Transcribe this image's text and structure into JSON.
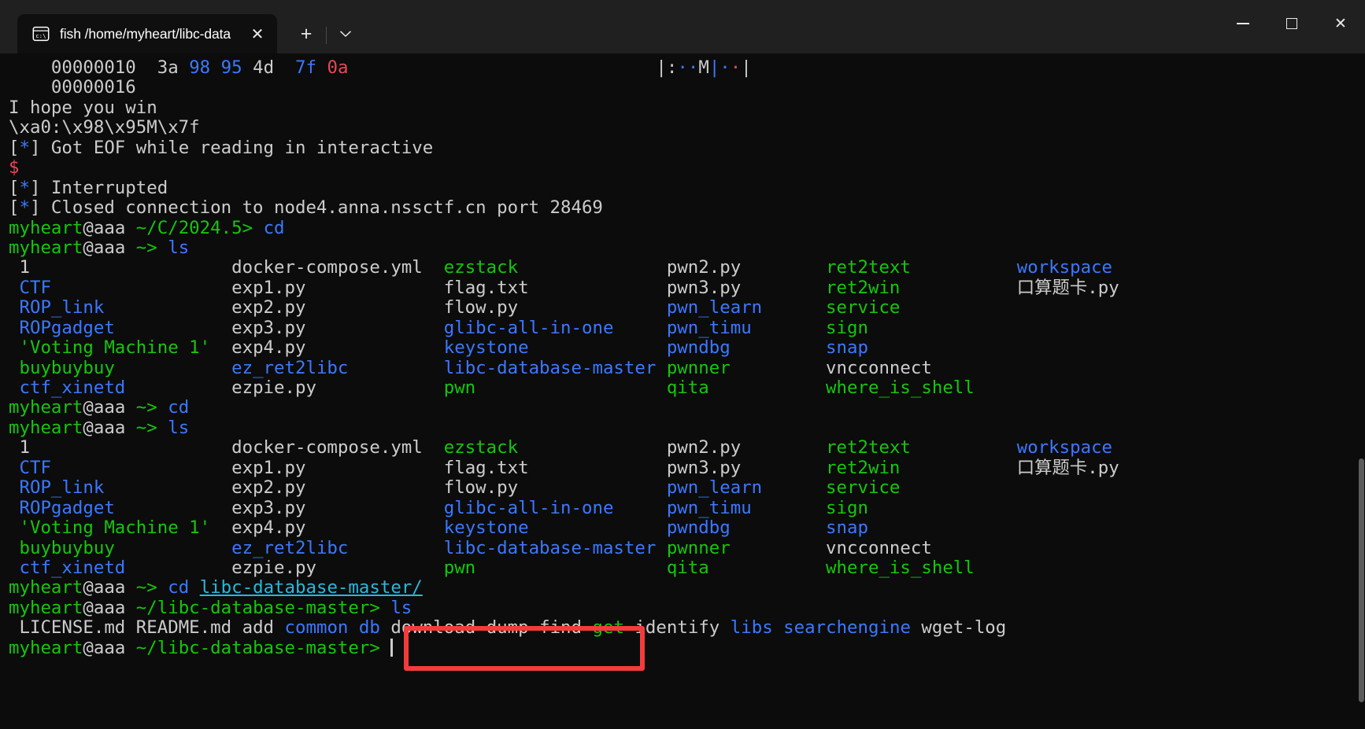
{
  "window": {
    "tab": {
      "icon": "console-cmd-icon",
      "title": "fish /home/myheart/libc-data",
      "close_label": "✕"
    },
    "new_tab_label": "+",
    "dropdown_label": "⌄",
    "controls": {
      "minimize": "minimize",
      "maximize": "maximize",
      "close": "✕"
    }
  },
  "colors": {
    "terminal_bg": "#0c0c0c",
    "chrome_bg": "#202020",
    "tab_bg": "#0f0f0f",
    "white": "#cccccc",
    "blue": "#3b78ff",
    "green": "#16c60c",
    "cyan": "#29b8db",
    "red": "#e74856",
    "annotation_red": "#f43b3b"
  },
  "annotation": {
    "name": "red-highlight-box",
    "target_text": "libc-database-master"
  },
  "terminal": {
    "hexdump": {
      "line1_offset": "00000010",
      "line1_bytes": [
        "3a",
        "98",
        "95",
        "4d",
        "7f",
        "0a"
      ],
      "line1_byte_colors": [
        "white",
        "blue",
        "blue",
        "white",
        "blue",
        "red"
      ],
      "line1_ascii_left": "|",
      "line1_ascii": [
        ":",
        "·",
        "·",
        "M",
        "|",
        "·",
        "·"
      ],
      "line1_ascii_colors": [
        "white",
        "blue",
        "blue",
        "white",
        "blue",
        "blue",
        "red"
      ],
      "line1_ascii_right": "|",
      "line2_offset": "00000016"
    },
    "messages": {
      "hope": "I hope you win",
      "escaped": "\\xa0:\\x98\\x95M\\x7f",
      "eof_prefix": "[",
      "eof_star": "*",
      "eof_suffix": "] Got EOF while reading in interactive",
      "dollar": "$",
      "interrupted": "] Interrupted",
      "closed": "] Closed connection to node4.anna.nssctf.cn port 28469"
    },
    "prompts": {
      "user": "myheart",
      "at_host": "@aaa",
      "path_a": "~/C/2024.5>",
      "path_home": "~>",
      "path_libc": "~/libc-database-master>",
      "cmd_cd": "cd",
      "cmd_ls": "ls",
      "cd_arg": "libc-database-master/"
    },
    "listing_home": {
      "columns": [
        {
          "entries": [
            {
              "text": "1",
              "color": "white"
            },
            {
              "text": "CTF",
              "color": "blue"
            },
            {
              "text": "ROP_link",
              "color": "blue"
            },
            {
              "text": "ROPgadget",
              "color": "blue"
            },
            {
              "text": "'Voting Machine 1'",
              "color": "green"
            },
            {
              "text": "buybuybuy",
              "color": "green"
            },
            {
              "text": "ctf_xinetd",
              "color": "blue"
            }
          ]
        },
        {
          "entries": [
            {
              "text": "docker-compose.yml",
              "color": "white"
            },
            {
              "text": "exp1.py",
              "color": "white"
            },
            {
              "text": "exp2.py",
              "color": "white"
            },
            {
              "text": "exp3.py",
              "color": "white"
            },
            {
              "text": "exp4.py",
              "color": "white"
            },
            {
              "text": "ez_ret2libc",
              "color": "blue"
            },
            {
              "text": "ezpie.py",
              "color": "white"
            }
          ]
        },
        {
          "entries": [
            {
              "text": "ezstack",
              "color": "green"
            },
            {
              "text": "flag.txt",
              "color": "white"
            },
            {
              "text": "flow.py",
              "color": "white"
            },
            {
              "text": "glibc-all-in-one",
              "color": "blue"
            },
            {
              "text": "keystone",
              "color": "blue"
            },
            {
              "text": "libc-database-master",
              "color": "blue"
            },
            {
              "text": "pwn",
              "color": "green"
            }
          ]
        },
        {
          "entries": [
            {
              "text": "pwn2.py",
              "color": "white"
            },
            {
              "text": "pwn3.py",
              "color": "white"
            },
            {
              "text": "pwn_learn",
              "color": "blue"
            },
            {
              "text": "pwn_timu",
              "color": "blue"
            },
            {
              "text": "pwndbg",
              "color": "blue"
            },
            {
              "text": "pwnner",
              "color": "green"
            },
            {
              "text": "qita",
              "color": "green"
            }
          ]
        },
        {
          "entries": [
            {
              "text": "ret2text",
              "color": "green"
            },
            {
              "text": "ret2win",
              "color": "green"
            },
            {
              "text": "service",
              "color": "green"
            },
            {
              "text": "sign",
              "color": "green"
            },
            {
              "text": "snap",
              "color": "blue"
            },
            {
              "text": "vncconnect",
              "color": "white"
            },
            {
              "text": "where_is_shell",
              "color": "green"
            }
          ]
        },
        {
          "entries": [
            {
              "text": "workspace",
              "color": "blue"
            },
            {
              "text": "口算题卡.py",
              "color": "white"
            },
            {
              "text": "",
              "color": "white"
            },
            {
              "text": "",
              "color": "white"
            },
            {
              "text": "",
              "color": "white"
            },
            {
              "text": "",
              "color": "white"
            },
            {
              "text": "",
              "color": "white"
            }
          ]
        }
      ]
    },
    "listing_libc": [
      {
        "text": "LICENSE.md",
        "color": "white"
      },
      {
        "text": "README.md",
        "color": "white"
      },
      {
        "text": "add",
        "color": "white"
      },
      {
        "text": "common",
        "color": "blue"
      },
      {
        "text": "db",
        "color": "blue"
      },
      {
        "text": "download",
        "color": "white"
      },
      {
        "text": "dump",
        "color": "white"
      },
      {
        "text": "find",
        "color": "white"
      },
      {
        "text": "get",
        "color": "green"
      },
      {
        "text": "identify",
        "color": "white"
      },
      {
        "text": "libs",
        "color": "blue"
      },
      {
        "text": "searchengine",
        "color": "blue"
      },
      {
        "text": "wget-log",
        "color": "white"
      }
    ]
  }
}
